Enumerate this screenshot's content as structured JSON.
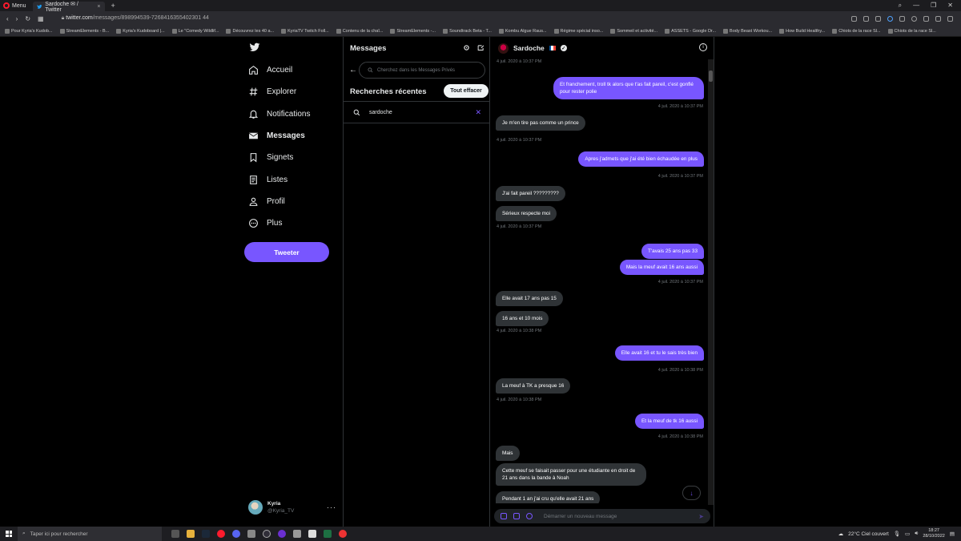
{
  "browser": {
    "menu_label": "Menu",
    "tab_title": "Sardoche ✉ / Twitter",
    "url_host": "twitter.com",
    "url_path": "/messages/898994539-7268416355402301 44",
    "bookmarks": [
      "Pour Kyria's Kudob...",
      "StreamElements - B...",
      "Kyria's Kudoboard |...",
      "Le \"Comedy Wildlif...",
      "Découvrez les 40 a...",
      "KyriaTV Twitch Foll...",
      "Contenu de la chaî...",
      "StreamElements -...",
      "Soundtrack Beta - T...",
      "Kombu Algue Raus...",
      "Régime spécial inso...",
      "Sommeil et activité...",
      "ASSETS - Google Dr...",
      "Body Beast Workou...",
      "How Build Healthy...",
      "Chiots de la race Sl...",
      "Chiots de la race Sl..."
    ]
  },
  "nav": {
    "items": [
      {
        "label": "Accueil",
        "icon": "home-icon"
      },
      {
        "label": "Explorer",
        "icon": "hashtag-icon"
      },
      {
        "label": "Notifications",
        "icon": "bell-icon"
      },
      {
        "label": "Messages",
        "icon": "envelope-icon"
      },
      {
        "label": "Signets",
        "icon": "bookmark-icon"
      },
      {
        "label": "Listes",
        "icon": "list-icon"
      },
      {
        "label": "Profil",
        "icon": "person-icon"
      },
      {
        "label": "Plus",
        "icon": "more-circle-icon"
      }
    ],
    "tweet_label": "Tweeter",
    "account_name": "Kyria",
    "account_handle": "@Kyria_TV"
  },
  "messages": {
    "title": "Messages",
    "search_placeholder": "Cherchez dans les Messages Privés",
    "recent_title": "Recherches récentes",
    "clear_label": "Tout effacer",
    "recent_query": "sardoche"
  },
  "conversation": {
    "name": "Sardoche",
    "compose_placeholder": "Démarrer un nouveau message",
    "messages": [
      {
        "dir": "ts-in",
        "text": "4 juil. 2020 à 10:37 PM"
      },
      {
        "dir": "out",
        "text": "Et franchement, troll tk alors que t'as fait pareil, c'est gonflé pour rester polie"
      },
      {
        "dir": "ts-out",
        "text": "4 juil. 2020 à 10:37 PM"
      },
      {
        "dir": "in",
        "text": "Je m'en tire pas comme un prince"
      },
      {
        "dir": "ts-in",
        "text": "4 juil. 2020 à 10:37 PM"
      },
      {
        "dir": "out",
        "text": "Apres j'admets que j'ai été bien échaudée en plus"
      },
      {
        "dir": "ts-out",
        "text": "4 juil. 2020 à 10:37 PM"
      },
      {
        "dir": "in",
        "text": "J'ai fait pareil ?????????"
      },
      {
        "dir": "in",
        "text": "Sérieux respecte moi"
      },
      {
        "dir": "ts-in",
        "text": "4 juil. 2020 à 10:37 PM"
      },
      {
        "dir": "out",
        "text": "T'avais 25 ans pas 33"
      },
      {
        "dir": "out",
        "text": "Mais la meuf avait 16 ans aussi"
      },
      {
        "dir": "ts-out",
        "text": "4 juil. 2020 à 10:37 PM"
      },
      {
        "dir": "in",
        "text": "Elle avait 17 ans pas 15"
      },
      {
        "dir": "in",
        "text": "16 ans et 10 mois"
      },
      {
        "dir": "ts-in",
        "text": "4 juil. 2020 à 10:38 PM"
      },
      {
        "dir": "out",
        "text": "Elle avait 16 et tu le sais très bien"
      },
      {
        "dir": "ts-out",
        "text": "4 juil. 2020 à 10:38 PM"
      },
      {
        "dir": "in",
        "text": "La meuf à TK a presque 16"
      },
      {
        "dir": "ts-in",
        "text": "4 juil. 2020 à 10:38 PM"
      },
      {
        "dir": "out",
        "text": "Et la meuf de tk 16 aussi"
      },
      {
        "dir": "ts-out",
        "text": "4 juil. 2020 à 10:38 PM"
      },
      {
        "dir": "in",
        "text": "Mais"
      },
      {
        "dir": "in",
        "text": "Cette meuf se faisait passer pour une étudiante en droit de 21 ans dans la bande à Noah"
      },
      {
        "dir": "in",
        "text": "Pendant 1 an j'ai cru qu'elle avait 21 ans"
      }
    ]
  },
  "taskbar": {
    "search_placeholder": "Taper ici pour rechercher",
    "weather": "22°C  Ciel couvert",
    "time": "18:27",
    "date": "28/10/2022"
  },
  "colors": {
    "accent": "#7856ff",
    "background": "#000000",
    "incoming_bubble": "#2f3336"
  }
}
